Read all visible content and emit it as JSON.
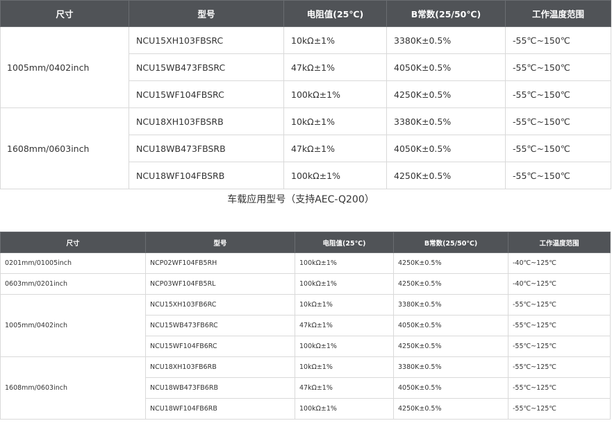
{
  "headers": [
    "尺寸",
    "型号",
    "电阻值(25℃)",
    "B常数(25/50℃)",
    "工作温度范围"
  ],
  "table1": {
    "groups": [
      {
        "size": "1005mm/0402inch",
        "rows": [
          {
            "model": "NCU15XH103FBSRC",
            "resistance": "10kΩ±1%",
            "b": "3380K±0.5%",
            "temp": "-55℃~150℃"
          },
          {
            "model": "NCU15WB473FBSRC",
            "resistance": "47kΩ±1%",
            "b": "4050K±0.5%",
            "temp": "-55℃~150℃"
          },
          {
            "model": "NCU15WF104FBSRC",
            "resistance": "100kΩ±1%",
            "b": "4250K±0.5%",
            "temp": "-55℃~150℃"
          }
        ]
      },
      {
        "size": "1608mm/0603inch",
        "rows": [
          {
            "model": "NCU18XH103FBSRB",
            "resistance": "10kΩ±1%",
            "b": "3380K±0.5%",
            "temp": "-55℃~150℃"
          },
          {
            "model": "NCU18WB473FBSRB",
            "resistance": "47kΩ±1%",
            "b": "4050K±0.5%",
            "temp": "-55℃~150℃"
          },
          {
            "model": "NCU18WF104FBSRB",
            "resistance": "100kΩ±1%",
            "b": "4250K±0.5%",
            "temp": "-55℃~150℃"
          }
        ]
      }
    ]
  },
  "caption": "车载应用型号（支持AEC-Q200）",
  "table2": {
    "groups": [
      {
        "size": "0201mm/01005inch",
        "rows": [
          {
            "model": "NCP02WF104FB5RH",
            "resistance": "100kΩ±1%",
            "b": "4250K±0.5%",
            "temp": "-40℃~125℃"
          }
        ]
      },
      {
        "size": "0603mm/0201inch",
        "rows": [
          {
            "model": "NCP03WF104FB5RL",
            "resistance": "100kΩ±1%",
            "b": "4250K±0.5%",
            "temp": "-40℃~125℃"
          }
        ]
      },
      {
        "size": "1005mm/0402inch",
        "rows": [
          {
            "model": "NCU15XH103FB6RC",
            "resistance": "10kΩ±1%",
            "b": "3380K±0.5%",
            "temp": "-55℃~125℃"
          },
          {
            "model": "NCU15WB473FB6RC",
            "resistance": "47kΩ±1%",
            "b": "4050K±0.5%",
            "temp": "-55℃~125℃"
          },
          {
            "model": "NCU15WF104FB6RC",
            "resistance": "100kΩ±1%",
            "b": "4250K±0.5%",
            "temp": "-55℃~125℃"
          }
        ]
      },
      {
        "size": "1608mm/0603inch",
        "rows": [
          {
            "model": "NCU18XH103FB6RB",
            "resistance": "10kΩ±1%",
            "b": "3380K±0.5%",
            "temp": "-55℃~125℃"
          },
          {
            "model": "NCU18WB473FB6RB",
            "resistance": "47kΩ±1%",
            "b": "4050K±0.5%",
            "temp": "-55℃~125℃"
          },
          {
            "model": "NCU18WF104FB6RB",
            "resistance": "100kΩ±1%",
            "b": "4250K±0.5%",
            "temp": "-55℃~125℃"
          }
        ]
      }
    ]
  }
}
